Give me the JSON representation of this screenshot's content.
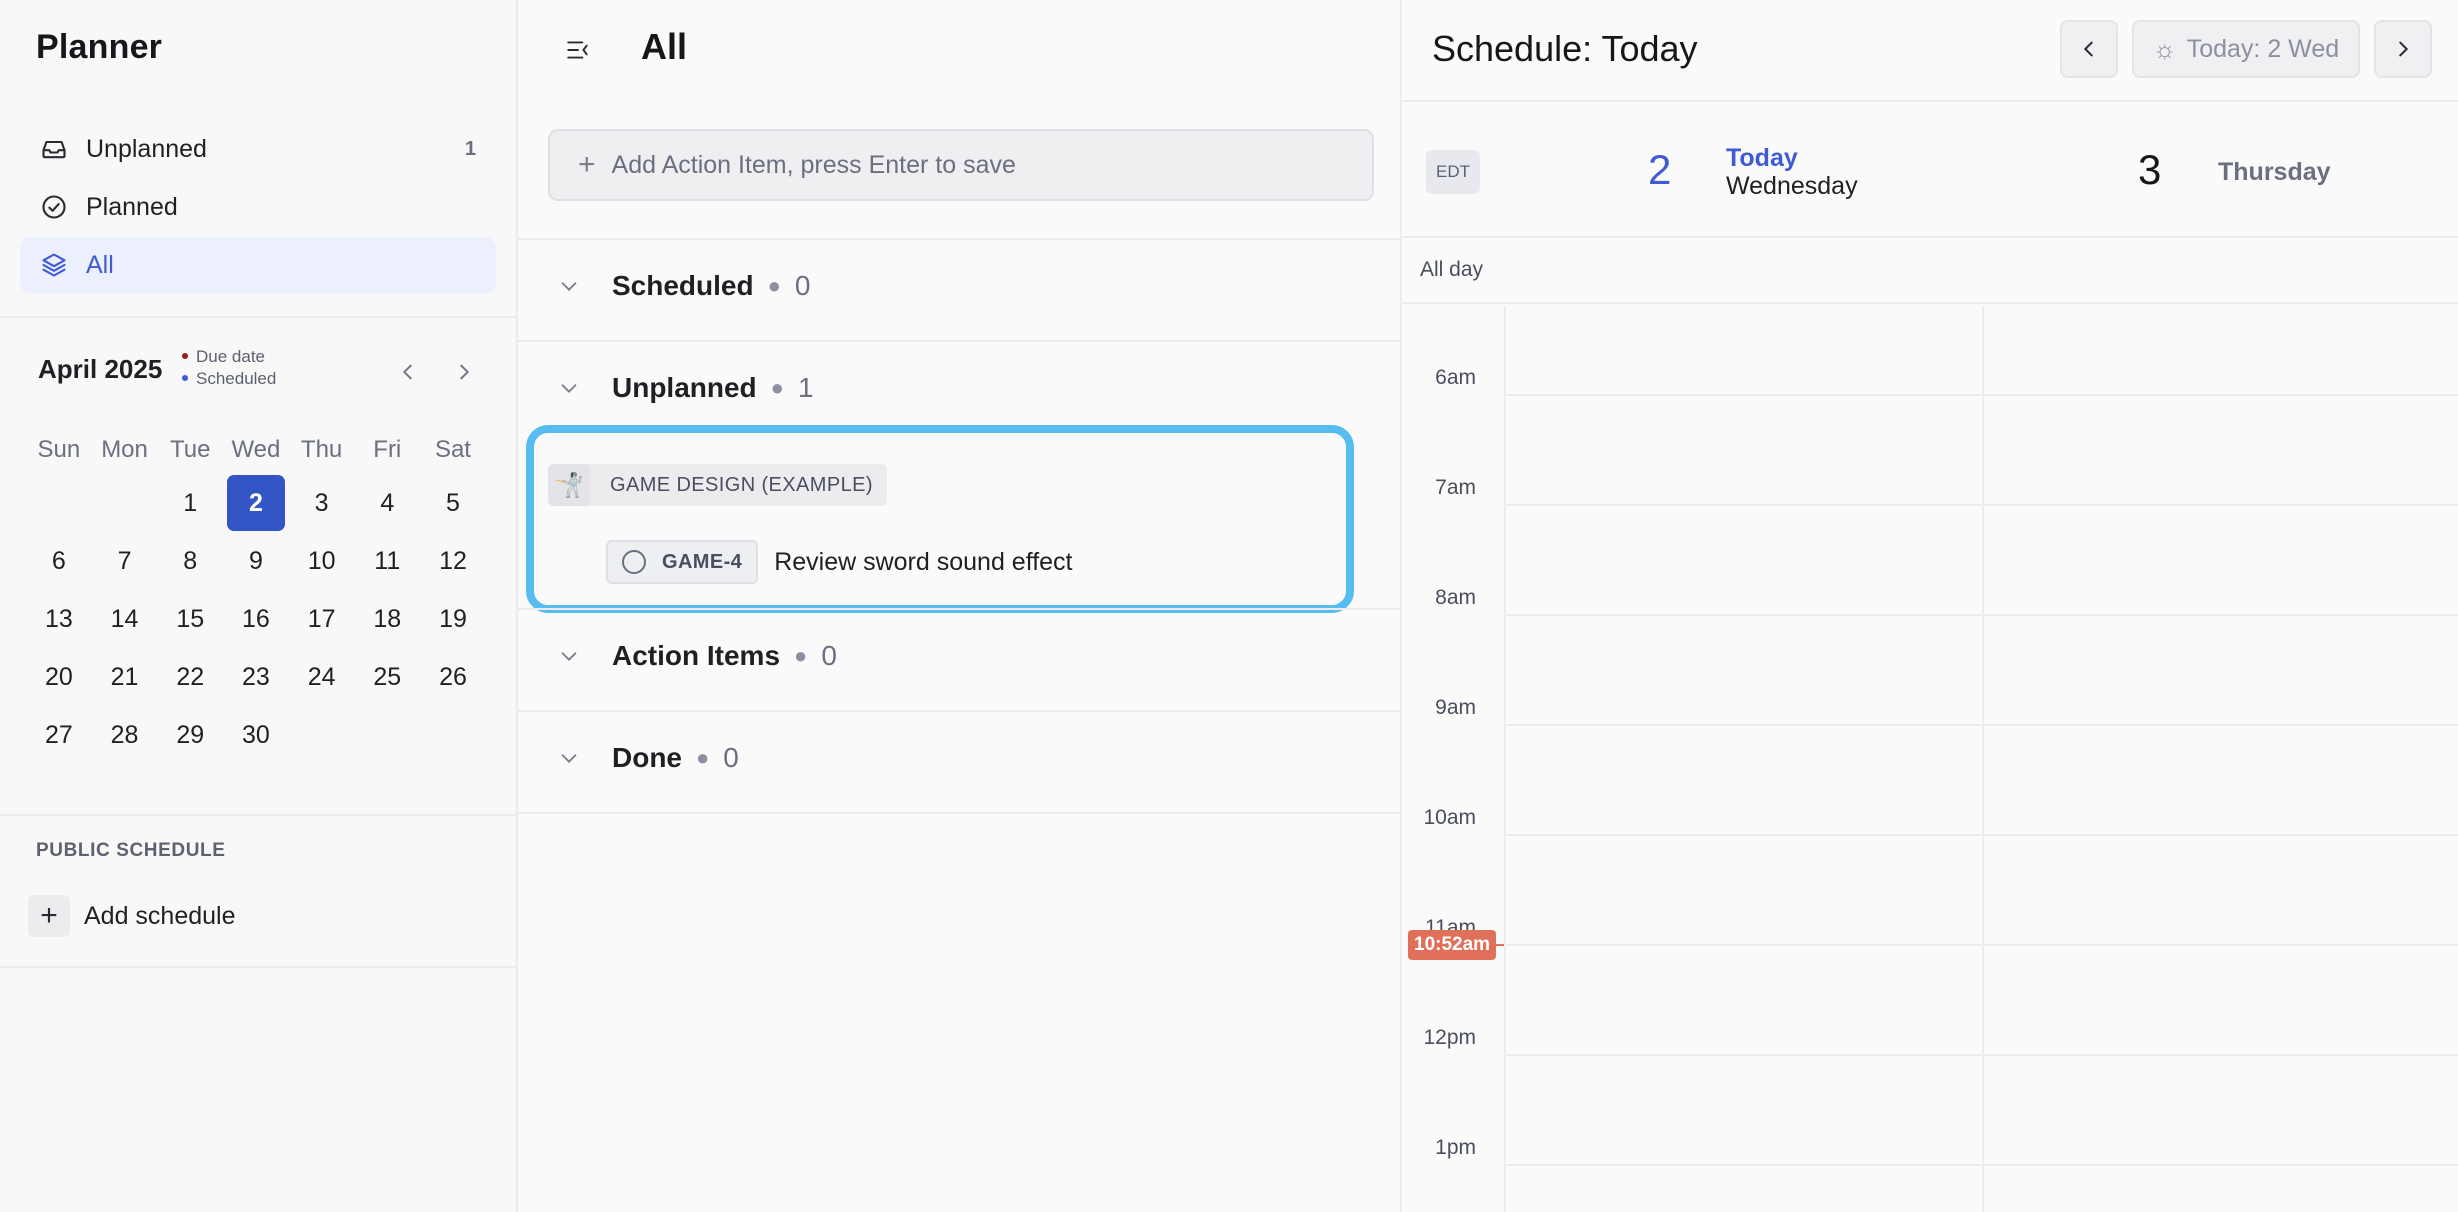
{
  "sidebar": {
    "app_title": "Planner",
    "nav": [
      {
        "label": "Unplanned",
        "count": "1",
        "icon": "inbox-icon"
      },
      {
        "label": "Planned",
        "count": "",
        "icon": "check-circle-icon"
      },
      {
        "label": "All",
        "count": "",
        "icon": "layers-icon",
        "active": true
      }
    ],
    "calendar": {
      "month": "April 2025",
      "legend_due": "Due date",
      "legend_scheduled": "Scheduled",
      "legend_due_color": "#9b1c1c",
      "legend_scheduled_color": "#3f5bd4",
      "weekdays": [
        "Sun",
        "Mon",
        "Tue",
        "Wed",
        "Thu",
        "Fri",
        "Sat"
      ],
      "weeks": [
        [
          "",
          "",
          "1",
          "2",
          "3",
          "4",
          "5"
        ],
        [
          "6",
          "7",
          "8",
          "9",
          "10",
          "11",
          "12"
        ],
        [
          "13",
          "14",
          "15",
          "16",
          "17",
          "18",
          "19"
        ],
        [
          "20",
          "21",
          "22",
          "23",
          "24",
          "25",
          "26"
        ],
        [
          "27",
          "28",
          "29",
          "30",
          "",
          "",
          ""
        ]
      ],
      "selected_day": "2"
    },
    "public_schedule_title": "PUBLIC SCHEDULE",
    "add_schedule_label": "Add schedule"
  },
  "middle": {
    "title": "All",
    "add_placeholder": "Add Action Item, press Enter to save",
    "groups": {
      "scheduled": {
        "name": "Scheduled",
        "count": "0"
      },
      "unplanned": {
        "name": "Unplanned",
        "count": "1"
      },
      "action_items": {
        "name": "Action Items",
        "count": "0"
      },
      "done": {
        "name": "Done",
        "count": "0"
      }
    },
    "project": {
      "emoji": "🤺",
      "name": "GAME DESIGN (EXAMPLE)"
    },
    "task": {
      "id": "GAME-4",
      "title": "Review sword sound effect"
    },
    "highlight_color": "#57bdf0"
  },
  "schedule": {
    "title": "Schedule: Today",
    "today_button": "Today: 2 Wed",
    "timezone": "EDT",
    "today_num": "2",
    "today_word": "Today",
    "today_day": "Wednesday",
    "next_num": "3",
    "next_day": "Thursday",
    "allday_label": "All day",
    "hours": [
      "6am",
      "7am",
      "8am",
      "9am",
      "10am",
      "11am",
      "12pm",
      "1pm"
    ],
    "now_label": "10:52am",
    "now_color": "#e0705a",
    "accent_color": "#3f5bd4"
  }
}
